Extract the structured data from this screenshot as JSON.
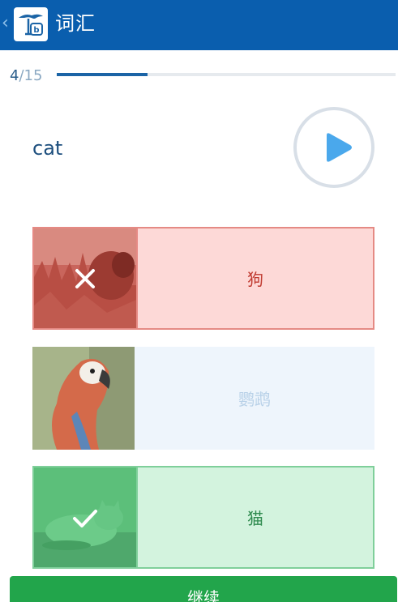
{
  "header": {
    "back_icon": "‹",
    "title": "词汇",
    "logo": "app-logo-icon",
    "background": "#0a5eae"
  },
  "progress": {
    "current": "4",
    "total": "/15",
    "fraction": 0.267,
    "fill_color": "#1b64a6"
  },
  "question": {
    "word": "cat",
    "play_icon": "play-icon"
  },
  "options": [
    {
      "label": "狗",
      "image": "dog-photo",
      "state": "wrong",
      "mark_icon": "cross-icon"
    },
    {
      "label": "鹦鹉",
      "image": "parrot-photo",
      "state": "neutral"
    },
    {
      "label": "猫",
      "image": "cat-photo",
      "state": "correct",
      "mark_icon": "check-icon"
    }
  ],
  "continue_button": {
    "label": "继续",
    "color": "#22a54b"
  }
}
